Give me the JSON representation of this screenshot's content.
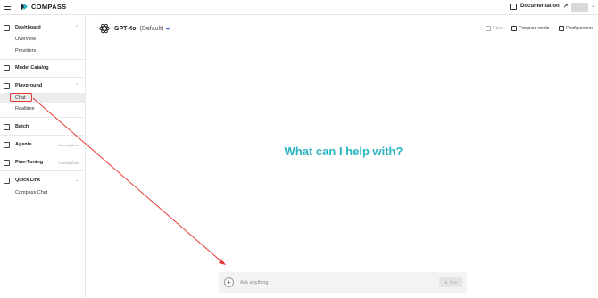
{
  "topbar": {
    "brand": "COMPASS",
    "documentation_label": "Documentation",
    "documentation_arrow": "↗",
    "avatar_caret": "⌄"
  },
  "sidebar": {
    "dashboard": {
      "label": "Dashboard",
      "chevron": "⌃",
      "items": [
        "Overview",
        "Providers"
      ]
    },
    "model_catalog": {
      "label": "Model Catalog"
    },
    "playground": {
      "label": "Playground",
      "chevron": "⌃",
      "items": [
        "Chat",
        "Realtime"
      ]
    },
    "batch": {
      "label": "Batch"
    },
    "agents": {
      "label": "Agents",
      "badge": "Coming Soon"
    },
    "fine_tuning": {
      "label": "Fine-Tuning",
      "badge": "Coming Soon"
    },
    "quick_link": {
      "label": "Quick Link",
      "chevron": "⌄",
      "items": [
        "Compass Chat"
      ]
    }
  },
  "main": {
    "model_name": "GPT-4o",
    "model_tag": "(Default)",
    "actions": {
      "clear": "Clear",
      "compare": "Compare mode",
      "config": "Configuration"
    },
    "hero": "What can I help with?",
    "input_placeholder": "Ask anything",
    "plus": "+",
    "run": "Run"
  },
  "colors": {
    "hero": "#2bb4c1",
    "annotation": "#e53935",
    "model_caret": "#2a66c9"
  }
}
